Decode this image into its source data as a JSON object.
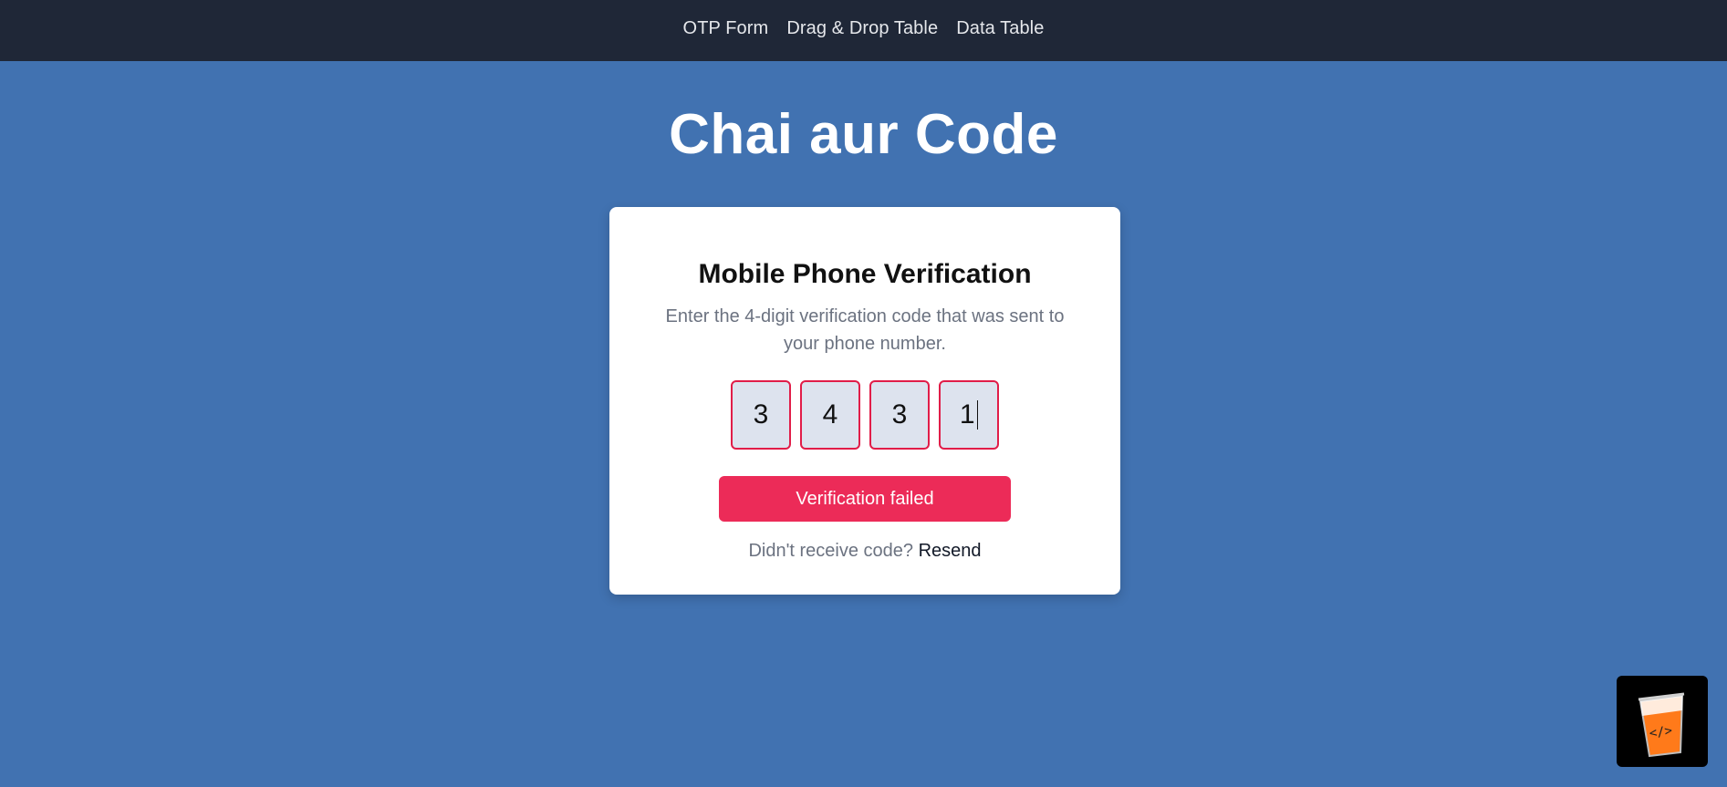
{
  "nav": {
    "items": [
      {
        "label": "OTP Form"
      },
      {
        "label": "Drag & Drop Table"
      },
      {
        "label": "Data Table"
      }
    ]
  },
  "header": {
    "title": "Chai aur Code"
  },
  "card": {
    "title": "Mobile Phone Verification",
    "description": "Enter the 4-digit verification code that was sent to your phone number.",
    "otp_digits": [
      "3",
      "4",
      "3",
      "1"
    ],
    "submit_label": "Verification failed",
    "resend_prompt": "Didn't receive code?",
    "resend_label": "Resend"
  },
  "badge": {
    "icon": "chai-cup-icon"
  },
  "colors": {
    "background": "#4172b1",
    "nav_bg": "#1f2737",
    "error": "#ec2b58",
    "otp_border": "#e11d48"
  }
}
